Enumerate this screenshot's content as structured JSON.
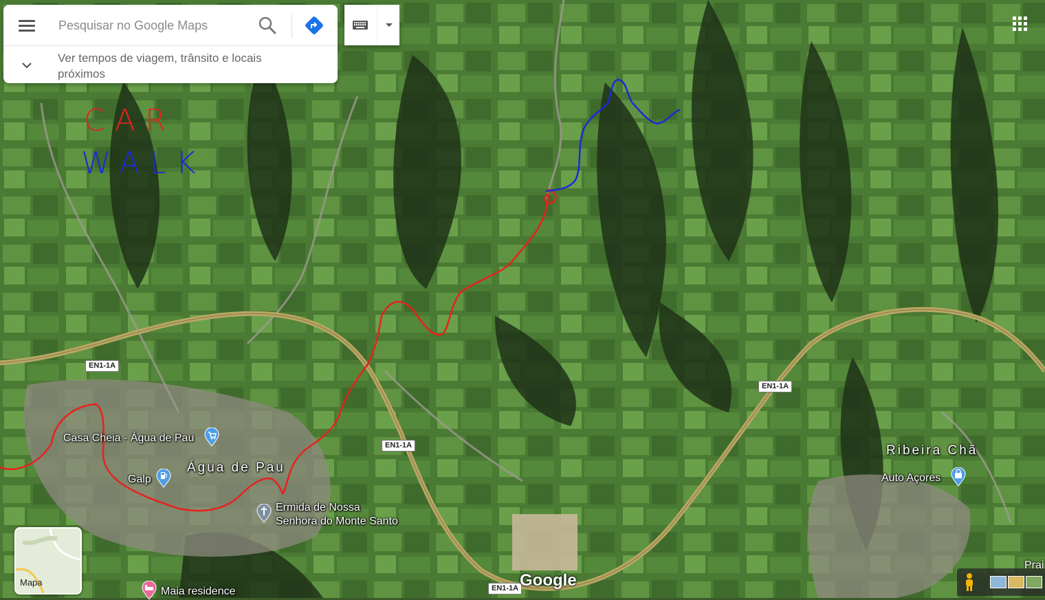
{
  "search": {
    "placeholder": "Pesquisar no Google Maps"
  },
  "subpanel": {
    "text": "Ver tempos de viagem, trânsito e locais próximos"
  },
  "legend": {
    "car": "CAR",
    "walk": "WALK",
    "car_color": "#e8211d",
    "walk_color": "#1a2bd6"
  },
  "road_shields": [
    "EN1-1A",
    "EN1-1A",
    "EN1-1A",
    "EN1-1A"
  ],
  "places": {
    "casa_cheia": "Casa Cheia - Água de Pau",
    "galp": "Galp",
    "agua_de_pau": "Água de Pau",
    "ermida_line1": "Ermida de Nossa",
    "ermida_line2": "Senhora do Monte Santo",
    "ribeira_cha": "Ribeira Chã",
    "auto_acores": "Auto Açores",
    "maia": "Maia residence",
    "prai": "Prai"
  },
  "minimap": {
    "label": "Mapa"
  },
  "brand": "Google",
  "colors": {
    "route_car": "#e8211d",
    "route_walk": "#1a2bd6",
    "highway": "#b9a763",
    "accent": "#1a73e8",
    "pin": "#4e9ee6"
  }
}
